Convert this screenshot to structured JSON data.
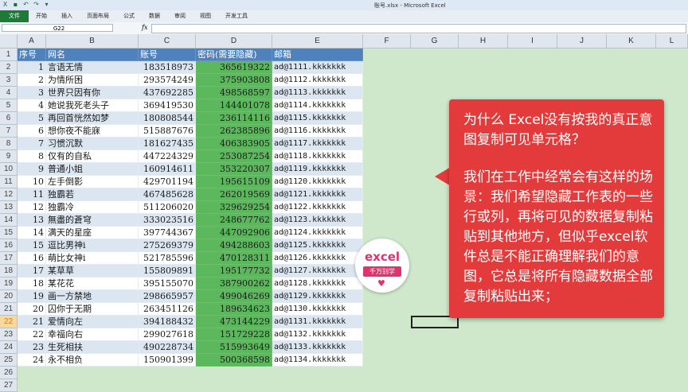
{
  "window": {
    "title": "账号.xlsx - Microsoft Excel"
  },
  "ribbon": {
    "tabs": [
      "文件",
      "开始",
      "插入",
      "页面布局",
      "公式",
      "数据",
      "审阅",
      "视图",
      "开发工具"
    ]
  },
  "formula_bar": {
    "name_box": "G22",
    "fx_label": "fx",
    "formula": ""
  },
  "columns": [
    "A",
    "B",
    "C",
    "D",
    "E",
    "F",
    "G",
    "H",
    "I",
    "J",
    "K",
    "L"
  ],
  "rows": [
    "1",
    "2",
    "3",
    "4",
    "5",
    "6",
    "7",
    "8",
    "9",
    "10",
    "11",
    "12",
    "13",
    "14",
    "15",
    "16",
    "17",
    "18",
    "19",
    "20",
    "21",
    "22",
    "23",
    "24",
    "25",
    "26",
    "27"
  ],
  "active_row": "22",
  "table": {
    "headers": [
      "序号",
      "网名",
      "账号",
      "密码(需要隐藏)",
      "邮箱"
    ],
    "records": [
      [
        "1",
        "言语无情",
        "183518973",
        "365619322",
        "ad@1111.kkkkkkk"
      ],
      [
        "2",
        "为情所困",
        "293574249",
        "375903808",
        "ad@1112.kkkkkkk"
      ],
      [
        "3",
        "世界只因有你",
        "437692285",
        "498568597",
        "ad@1113.kkkkkkk"
      ],
      [
        "4",
        "她说我死老头子",
        "369419530",
        "144401078",
        "ad@1114.kkkkkkk"
      ],
      [
        "5",
        "再回首恍然如梦",
        "180808544",
        "236114116",
        "ad@1115.kkkkkkk"
      ],
      [
        "6",
        "想你夜不能寐",
        "515887676",
        "262385896",
        "ad@1116.kkkkkkk"
      ],
      [
        "7",
        "习惯沉默",
        "181627435",
        "406383905",
        "ad@1117.kkkkkkk"
      ],
      [
        "8",
        "仅有的自私",
        "447224329",
        "253087254",
        "ad@1118.kkkkkkk"
      ],
      [
        "9",
        "普通小姐",
        "160914611",
        "353220307",
        "ad@1119.kkkkkkk"
      ],
      [
        "10",
        "左手倒影",
        "429701194",
        "195615109",
        "ad@1120.kkkkkkk"
      ],
      [
        "11",
        "独霸若",
        "467485628",
        "262019569",
        "ad@1121.kkkkkkk"
      ],
      [
        "12",
        "独霸冷",
        "511206020",
        "329629254",
        "ad@1122.kkkkkkk"
      ],
      [
        "13",
        "無盡的蒼穹",
        "333023516",
        "248677762",
        "ad@1123.kkkkkkk"
      ],
      [
        "14",
        "满天的星座",
        "397744367",
        "447092906",
        "ad@1124.kkkkkkk"
      ],
      [
        "15",
        "逗比男神i",
        "275269379",
        "494288603",
        "ad@1125.kkkkkkk"
      ],
      [
        "16",
        "萌比女神i",
        "521785596",
        "470128311",
        "ad@1126.kkkkkkk"
      ],
      [
        "17",
        "某草草",
        "155809891",
        "195177732",
        "ad@1127.kkkkkkk"
      ],
      [
        "18",
        "某花花",
        "395155070",
        "387900262",
        "ad@1128.kkkkkkk"
      ],
      [
        "19",
        "画一方禁地",
        "298665957",
        "499046269",
        "ad@1129.kkkkkkk"
      ],
      [
        "20",
        "囚你于无期",
        "263451126",
        "189634623",
        "ad@1130.kkkkkkk"
      ],
      [
        "21",
        "爱情向左",
        "394188432",
        "473144229",
        "ad@1131.kkkkkkk"
      ],
      [
        "22",
        "幸福向右",
        "299027618",
        "151729228",
        "ad@1132.kkkkkkk"
      ],
      [
        "23",
        "生死相扶",
        "490228734",
        "515993649",
        "ad@1133.kkkkkkk"
      ],
      [
        "24",
        "永不相负",
        "150901399",
        "500368598",
        "ad@1134.kkkkkkk"
      ]
    ]
  },
  "callout": {
    "title": "为什么 Excel没有按我的真正意图复制可见单元格？",
    "body": "我们在工作中经常会有这样的场景：我们希望隐藏工作表的一些行或列，再将可见的数据复制粘贴到其他地方，但似乎excel软件总是不能正确理解我们的意图，它总是将所有隐藏数据全部复制粘贴出来；"
  },
  "logo": {
    "line1": "excel",
    "line2": "千万别学"
  },
  "colors": {
    "header_blue": "#4f81bd",
    "password_green": "#5cb85c",
    "callout_red": "#e33b3b"
  }
}
